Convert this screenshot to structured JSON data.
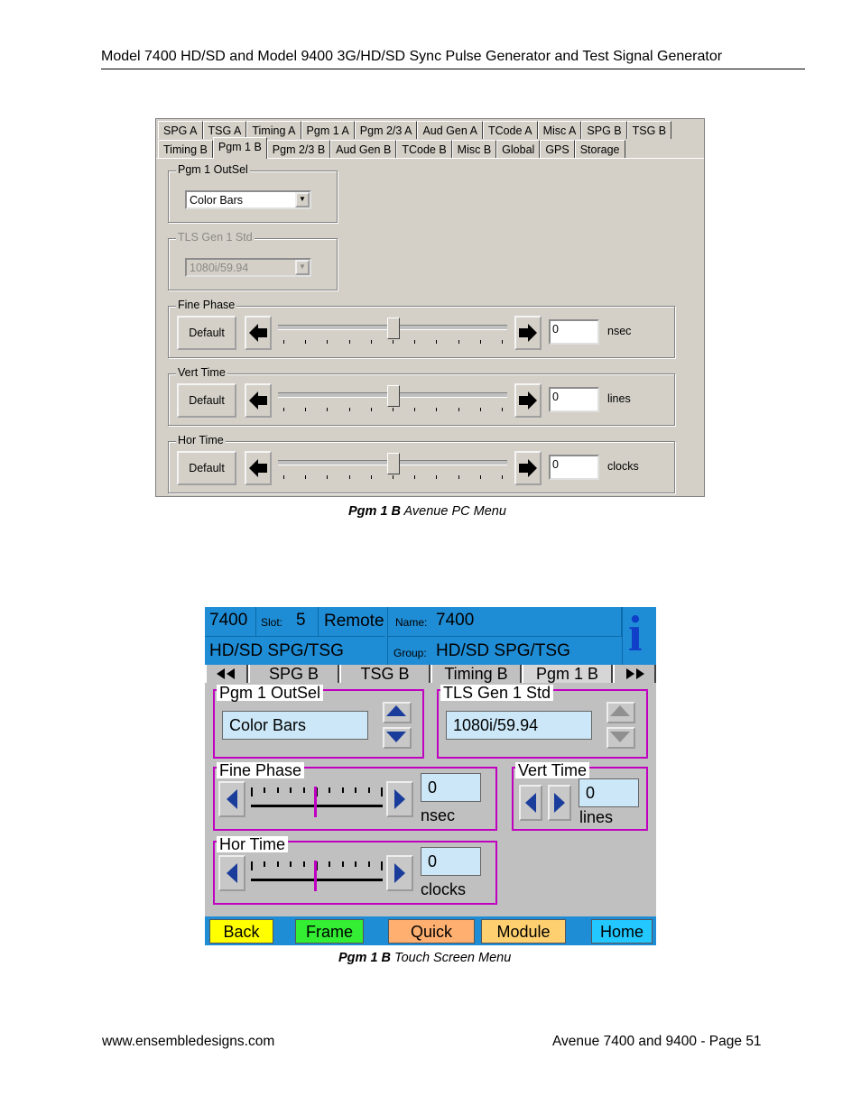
{
  "document": {
    "header_title": "Model 7400 HD/SD and Model 9400 3G/HD/SD Sync Pulse Generator and Test Signal Generator",
    "footer_url": "www.ensembledesigns.com",
    "footer_page": "Avenue 7400 and 9400 - Page 51"
  },
  "pc_menu": {
    "caption_bold": "Pgm 1 B",
    "caption_rest": " Avenue PC Menu",
    "tabs_top": [
      "SPG A",
      "TSG A",
      "Timing A",
      "Pgm 1 A",
      "Pgm 2/3 A",
      "Aud Gen A",
      "TCode A",
      "Misc A",
      "SPG B",
      "TSG B"
    ],
    "tabs_bottom": [
      "Timing B",
      "Pgm 1 B",
      "Pgm 2/3 B",
      "Aud Gen B",
      "TCode B",
      "Misc B",
      "Global",
      "GPS",
      "Storage"
    ],
    "active_tab": "Pgm 1 B",
    "outsel": {
      "label": "Pgm 1 OutSel",
      "value": "Color Bars"
    },
    "tls": {
      "label": "TLS Gen 1 Std",
      "value": "1080i/59.94",
      "disabled": true
    },
    "fine_phase": {
      "label": "Fine Phase",
      "default_label": "Default",
      "value": "0",
      "unit": "nsec",
      "position": 0.5
    },
    "vert_time": {
      "label": "Vert Time",
      "default_label": "Default",
      "value": "0",
      "unit": "lines",
      "position": 0.5
    },
    "hor_time": {
      "label": "Hor Time",
      "default_label": "Default",
      "value": "0",
      "unit": "clocks",
      "position": 0.5
    }
  },
  "touch_menu": {
    "caption_bold": "Pgm 1 B",
    "caption_rest": " Touch Screen Menu",
    "model": "7400",
    "slot_label": "Slot:",
    "slot": "5",
    "mode": "Remote",
    "name_label": "Name:",
    "name": "7400",
    "type": "HD/SD SPG/TSG",
    "group_label": "Group:",
    "group": "HD/SD SPG/TSG",
    "info_icon": "i",
    "tabs": [
      "SPG B",
      "TSG B",
      "Timing B",
      "Pgm 1 B"
    ],
    "active_tab": "Pgm 1 B",
    "outsel": {
      "label": "Pgm 1 OutSel",
      "value": "Color Bars"
    },
    "tls": {
      "label": "TLS Gen 1 Std",
      "value": "1080i/59.94"
    },
    "fine_phase": {
      "label": "Fine Phase",
      "value": "0",
      "unit": "nsec"
    },
    "vert_time": {
      "label": "Vert Time",
      "value": "0",
      "unit": "lines"
    },
    "hor_time": {
      "label": "Hor Time",
      "value": "0",
      "unit": "clocks"
    },
    "bottom_buttons": [
      {
        "label": "Back",
        "color": "#ffff00"
      },
      {
        "label": "Frame",
        "color": "#33ee33"
      },
      {
        "label": "Quick",
        "color": "#ffb070"
      },
      {
        "label": "Module",
        "color": "#ffd070"
      },
      {
        "label": "Home",
        "color": "#22c8ff"
      }
    ]
  }
}
